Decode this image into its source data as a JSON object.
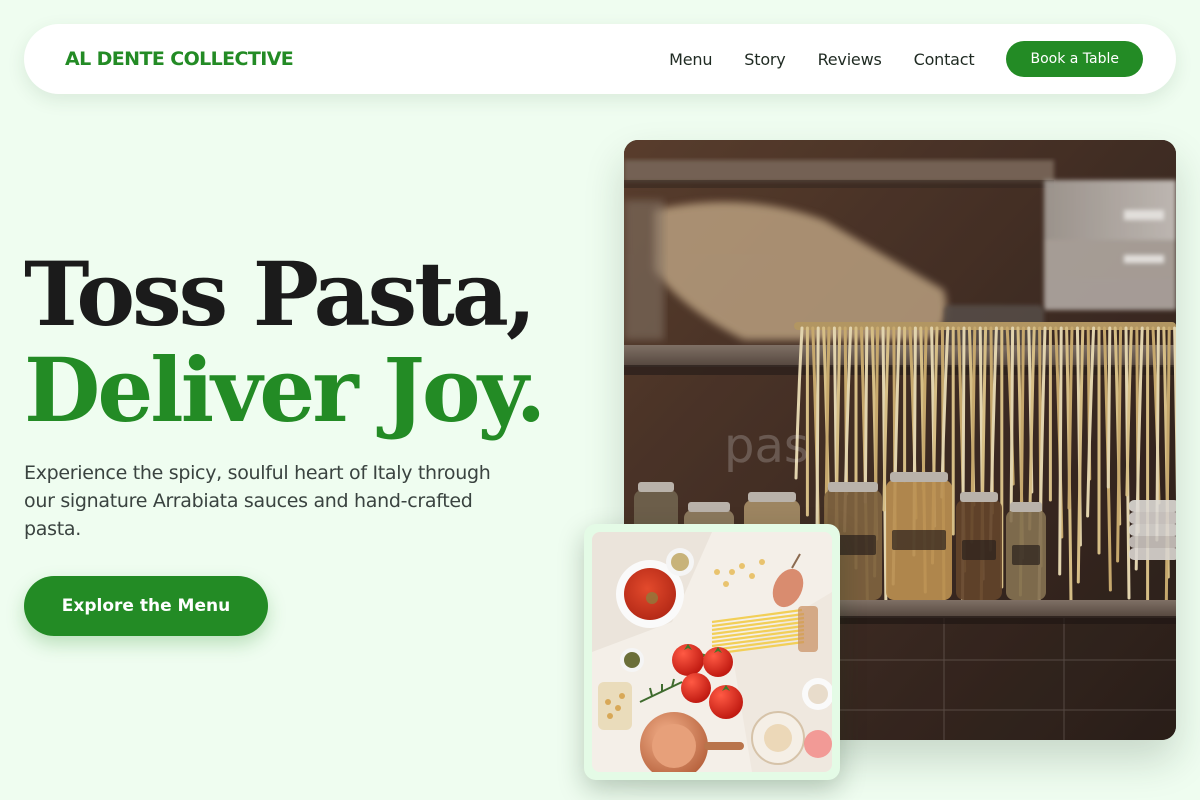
{
  "brand": "AL DENTE COLLECTIVE",
  "nav": {
    "links": [
      "Menu",
      "Story",
      "Reviews",
      "Contact"
    ],
    "cta": "Book a Table"
  },
  "hero": {
    "title_line1": "Toss Pasta,",
    "title_line2": "Deliver Joy.",
    "subtitle": "Experience the spicy, soulful heart of Italy through our signature Arrabiata sauces and hand-crafted pasta.",
    "cta": "Explore the Menu"
  },
  "images": {
    "main_watermark": "pas",
    "main_alt": "pantry-with-drying-pasta",
    "card_alt": "pasta-ingredients-flatlay"
  },
  "colors": {
    "brand_green": "#238b25",
    "page_background": "#effdf0",
    "heading_dark": "#1b1b1b"
  }
}
